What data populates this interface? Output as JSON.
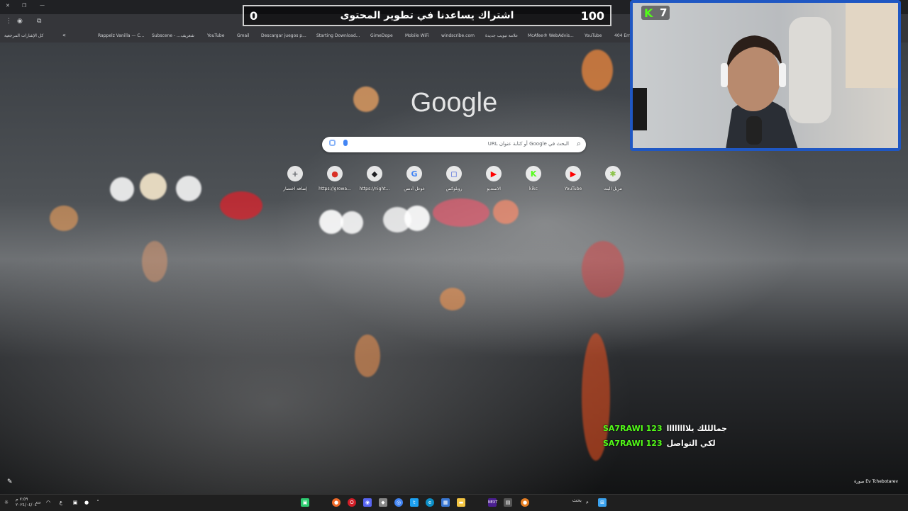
{
  "browser": {
    "bookmarks": [
      {
        "label": "Rappelz Vanilla — C..."
      },
      {
        "label": "Subscene - ...شعريف"
      },
      {
        "label": "YouTube"
      },
      {
        "label": "Gmail"
      },
      {
        "label": "Descargar juegos p..."
      },
      {
        "label": "Starting Download..."
      },
      {
        "label": "GimeDope"
      },
      {
        "label": "Mobile WiFi"
      },
      {
        "label": "windscribe.com"
      },
      {
        "label": "علامة تبويب جديدة"
      },
      {
        "label": "McAfee® WebAdvis..."
      },
      {
        "label": "YouTube"
      },
      {
        "label": "404 Err"
      }
    ],
    "bookmarks_all_label": "كل الإشارات المرجعية"
  },
  "subscriber_goal": {
    "min": "0",
    "max": "100",
    "text": "اشتراك يساعدنا في تطوير المحتوى",
    "progress_fraction": 0.0
  },
  "newtab": {
    "logo": "Google",
    "search_placeholder": "البحث في Google أو كتابة عنوان URL",
    "shortcuts": [
      {
        "label": "إضافة اختصار",
        "icon": "plus-icon",
        "glyph": "+",
        "color": "#5f6368"
      },
      {
        "label": "https://growa...",
        "icon": "apple-icon",
        "glyph": "●",
        "color": "#d93025"
      },
      {
        "label": "https://night...",
        "icon": "ghost-icon",
        "glyph": "◆",
        "color": "#202124"
      },
      {
        "label": "غوغل أدنس",
        "icon": "google-icon",
        "glyph": "G",
        "color": "#4285f4"
      },
      {
        "label": "روبلوكس",
        "icon": "roblox-icon",
        "glyph": "◻",
        "color": "#3b5bdb"
      },
      {
        "label": "الاستديو",
        "icon": "youtube-studio-icon",
        "glyph": "▶",
        "color": "#ff0000"
      },
      {
        "label": "kikc",
        "icon": "kick-icon",
        "glyph": "K",
        "color": "#53fc18"
      },
      {
        "label": "YouTube",
        "icon": "youtube-icon",
        "glyph": "▶",
        "color": "#ff0000"
      },
      {
        "label": "تنزيل البث",
        "icon": "download-icon",
        "glyph": "✱",
        "color": "#8bc34a"
      }
    ],
    "photo_credit": "صورة Ev Tchebotarev"
  },
  "stream": {
    "kick_viewers": "7",
    "chat": [
      {
        "user": "SA7RAWI 123",
        "message": "جمالللك يلاااااااا"
      },
      {
        "user": "SA7RAWI 123",
        "message": "لكي التواصل"
      }
    ]
  },
  "taskbar": {
    "search_label": "بحث",
    "clock_time": "٧:٥٩ م",
    "clock_date": "٢٠٢٤/٠٤/٠٤",
    "lang": "ع"
  },
  "colors": {
    "kick_green": "#53fc18",
    "webcam_border": "#1f57c3"
  }
}
